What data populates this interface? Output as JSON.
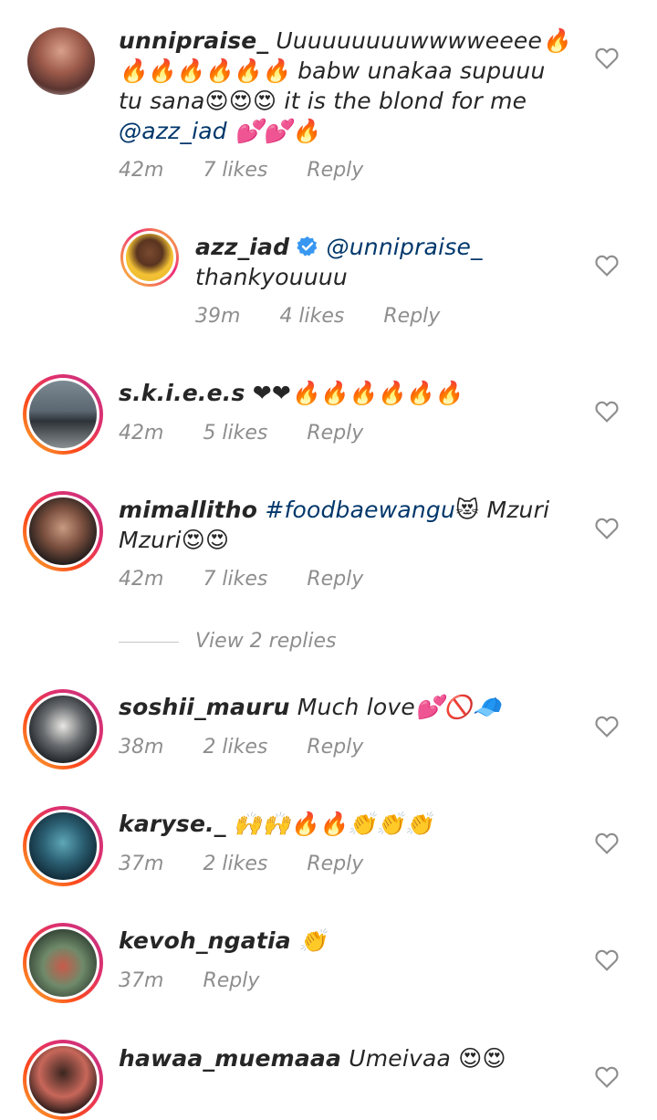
{
  "comments": [
    {
      "username": "unnipraise_",
      "text_lines": [
        "Uuuuuuuuuwwwweeee🔥",
        "🔥🔥🔥🔥🔥🔥 babw unakaa supuuu",
        "tu sana😍😍😍 it is the blond for me"
      ],
      "mention": "@azz_iad",
      "mention_suffix": " 💕💕🔥",
      "time": "42m",
      "likes": "7 likes",
      "reply": "Reply"
    },
    {
      "username": "azz_iad",
      "mention": "@unnipraise_",
      "text": "thankyouuuu",
      "time": "39m",
      "likes": "4 likes",
      "reply": "Reply"
    },
    {
      "username": "s.k.i.e.e.s",
      "text": "❤❤🔥🔥🔥🔥🔥🔥",
      "time": "42m",
      "likes": "5 likes",
      "reply": "Reply"
    },
    {
      "username": "mimallitho",
      "hashtag": "#foodbaewangu",
      "text_after": "😻 Mzuri",
      "text_line2": "Mzuri😍😍",
      "time": "42m",
      "likes": "7 likes",
      "reply": "Reply",
      "view_replies": "View 2 replies"
    },
    {
      "username": "soshii_mauru",
      "text": "Much love💕🚫🧢",
      "time": "38m",
      "likes": "2 likes",
      "reply": "Reply"
    },
    {
      "username": "karyse._",
      "text": "🙌🙌🔥🔥👏👏👏",
      "time": "37m",
      "likes": "2 likes",
      "reply": "Reply"
    },
    {
      "username": "kevoh_ngatia",
      "text": "👏",
      "time": "37m",
      "reply": "Reply"
    },
    {
      "username": "hawaa_muemaaa",
      "text": "Umeivaa 😍😍"
    }
  ],
  "icons": {
    "like": "heart-outline-icon",
    "verified": "verified-badge-icon"
  },
  "colors": {
    "link": "#00376b",
    "meta": "#8e8e8e",
    "verified": "#3897f0"
  }
}
